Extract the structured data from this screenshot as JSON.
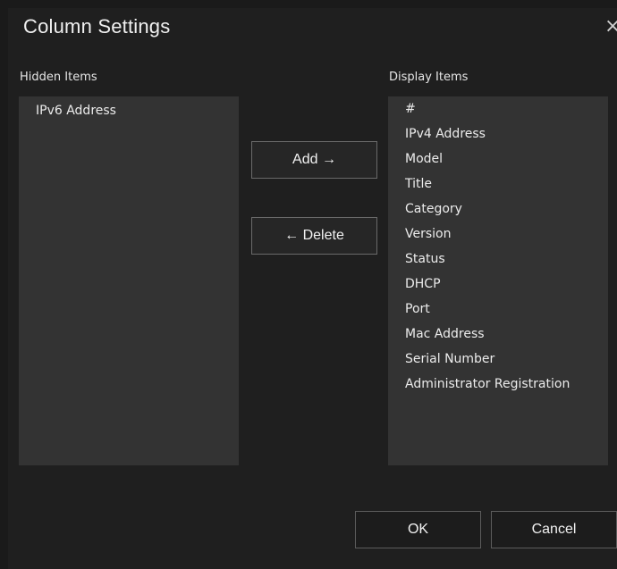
{
  "dialog": {
    "title": "Column Settings",
    "close_glyph": "×"
  },
  "hidden": {
    "label": "Hidden Items",
    "items": [
      "IPv6 Address"
    ]
  },
  "display": {
    "label": "Display Items",
    "items": [
      "#",
      "IPv4 Address",
      "Model",
      "Title",
      "Category",
      "Version",
      "Status",
      "DHCP",
      "Port",
      "Mac Address",
      "Serial Number",
      "Administrator Registration"
    ]
  },
  "buttons": {
    "add": "Add →",
    "delete": "← Delete",
    "ok": "OK",
    "cancel": "Cancel"
  },
  "colors": {
    "background": "#1f1f1f",
    "list_background": "#333333",
    "button_border": "#6a6a6a"
  }
}
